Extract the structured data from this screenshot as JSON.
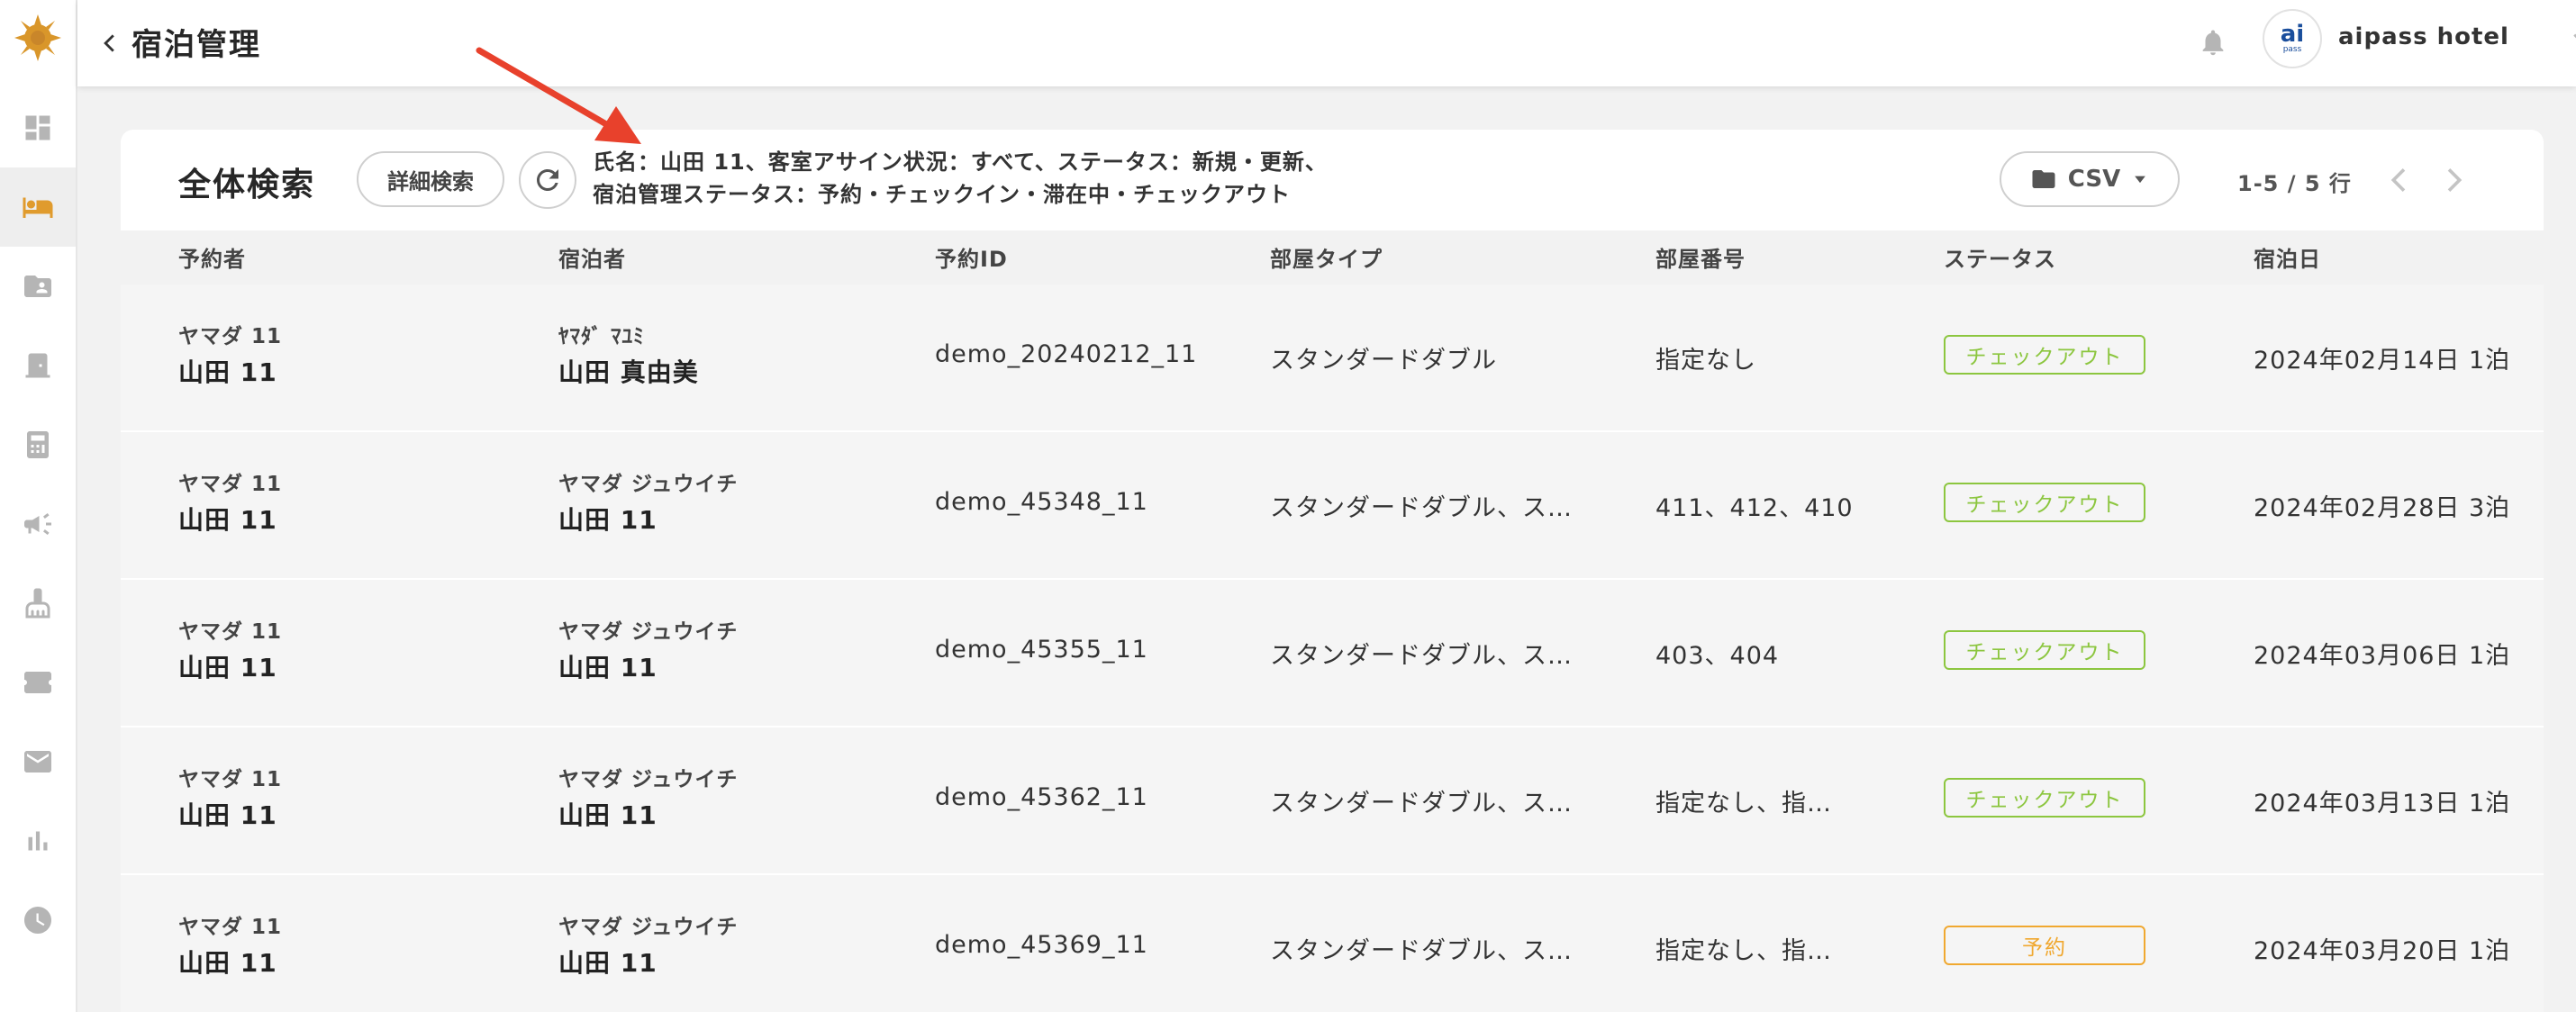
{
  "header": {
    "title": "宿泊管理",
    "avatar_ai": "ai",
    "avatar_pass": "pass",
    "hotel_name": "aipass hotel"
  },
  "toolbar": {
    "title": "全体検索",
    "detail_search_label": "詳細検索",
    "criteria_line1": "氏名：山田 11、客室アサイン状況：すべて、ステータス：新規・更新、",
    "criteria_line2": "宿泊管理ステータス：予約・チェックイン・滞在中・チェックアウト",
    "csv_label": "CSV",
    "pager_text": "1-5 / 5 行"
  },
  "table": {
    "headers": [
      "予約者",
      "宿泊者",
      "予約ID",
      "部屋タイプ",
      "部屋番号",
      "ステータス",
      "宿泊日"
    ],
    "rows": [
      {
        "booker_kana": "ヤマダ 11",
        "booker_name": "山田 11",
        "guest_kana": "ﾔﾏﾀﾞ ﾏﾕﾐ",
        "guest_name": "山田 真由美",
        "reservation_id": "demo_20240212_11",
        "room_type": "スタンダードダブル",
        "room_number": "指定なし",
        "status": "チェックアウト",
        "stay_date": "2024年02月14日 1泊"
      },
      {
        "booker_kana": "ヤマダ 11",
        "booker_name": "山田 11",
        "guest_kana": "ヤマダ ジュウイチ",
        "guest_name": "山田 11",
        "reservation_id": "demo_45348_11",
        "room_type": "スタンダードダブル、ス…",
        "room_number": "411、412、410",
        "status": "チェックアウト",
        "stay_date": "2024年02月28日 3泊"
      },
      {
        "booker_kana": "ヤマダ 11",
        "booker_name": "山田 11",
        "guest_kana": "ヤマダ ジュウイチ",
        "guest_name": "山田 11",
        "reservation_id": "demo_45355_11",
        "room_type": "スタンダードダブル、ス…",
        "room_number": "403、404",
        "status": "チェックアウト",
        "stay_date": "2024年03月06日 1泊"
      },
      {
        "booker_kana": "ヤマダ 11",
        "booker_name": "山田 11",
        "guest_kana": "ヤマダ ジュウイチ",
        "guest_name": "山田 11",
        "reservation_id": "demo_45362_11",
        "room_type": "スタンダードダブル、ス…",
        "room_number": "指定なし、指…",
        "status": "チェックアウト",
        "stay_date": "2024年03月13日 1泊"
      },
      {
        "booker_kana": "ヤマダ 11",
        "booker_name": "山田 11",
        "guest_kana": "ヤマダ ジュウイチ",
        "guest_name": "山田 11",
        "reservation_id": "demo_45369_11",
        "room_type": "スタンダードダブル、ス…",
        "room_number": "指定なし、指…",
        "status": "予約",
        "stay_date": "2024年03月20日 1泊"
      }
    ]
  },
  "colors": {
    "checkout": "#8cc63f",
    "reserved": "#f0a830",
    "arrow": "#e8412c",
    "logo": "#d9962a"
  },
  "sidebar_icons": [
    "dashboard-icon",
    "bed-icon",
    "guest-folder-icon",
    "door-icon",
    "calculator-icon",
    "megaphone-icon",
    "cleaning-icon",
    "ticket-icon",
    "mail-icon",
    "bar-chart-icon",
    "clock-icon"
  ]
}
